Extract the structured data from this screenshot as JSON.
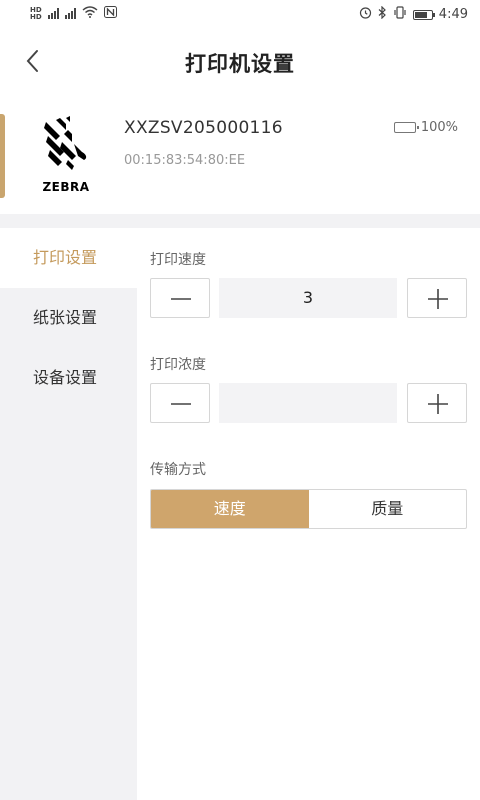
{
  "status_bar": {
    "time": "4:49",
    "left_icons": [
      "hd-icon",
      "4g-signal-icon",
      "4g-signal-icon",
      "wifi-icon",
      "nfc-icon"
    ],
    "right_icons": [
      "alarm-icon",
      "bluetooth-icon",
      "vibrate-icon",
      "battery-icon"
    ]
  },
  "header": {
    "title": "打印机设置",
    "back_icon": "chevron-left-icon"
  },
  "device": {
    "brand": "ZEBRA",
    "name": "XXZSV205000116",
    "mac": "00:15:83:54:80:EE",
    "battery_level": "100%",
    "accent_color": "#c9a56e"
  },
  "sidebar": {
    "items": [
      {
        "label": "打印设置",
        "active": true
      },
      {
        "label": "纸张设置",
        "active": false
      },
      {
        "label": "设备设置",
        "active": false
      }
    ]
  },
  "settings": {
    "print_speed": {
      "label": "打印速度",
      "value": "3"
    },
    "print_density": {
      "label": "打印浓度",
      "value": ""
    },
    "transfer_mode": {
      "label": "传输方式",
      "options": [
        "速度",
        "质量"
      ],
      "selected": "速度"
    }
  },
  "colors": {
    "accent": "#c49a5c",
    "selected_segment": "#cfa56c",
    "sidebar_bg": "#f2f2f4"
  }
}
